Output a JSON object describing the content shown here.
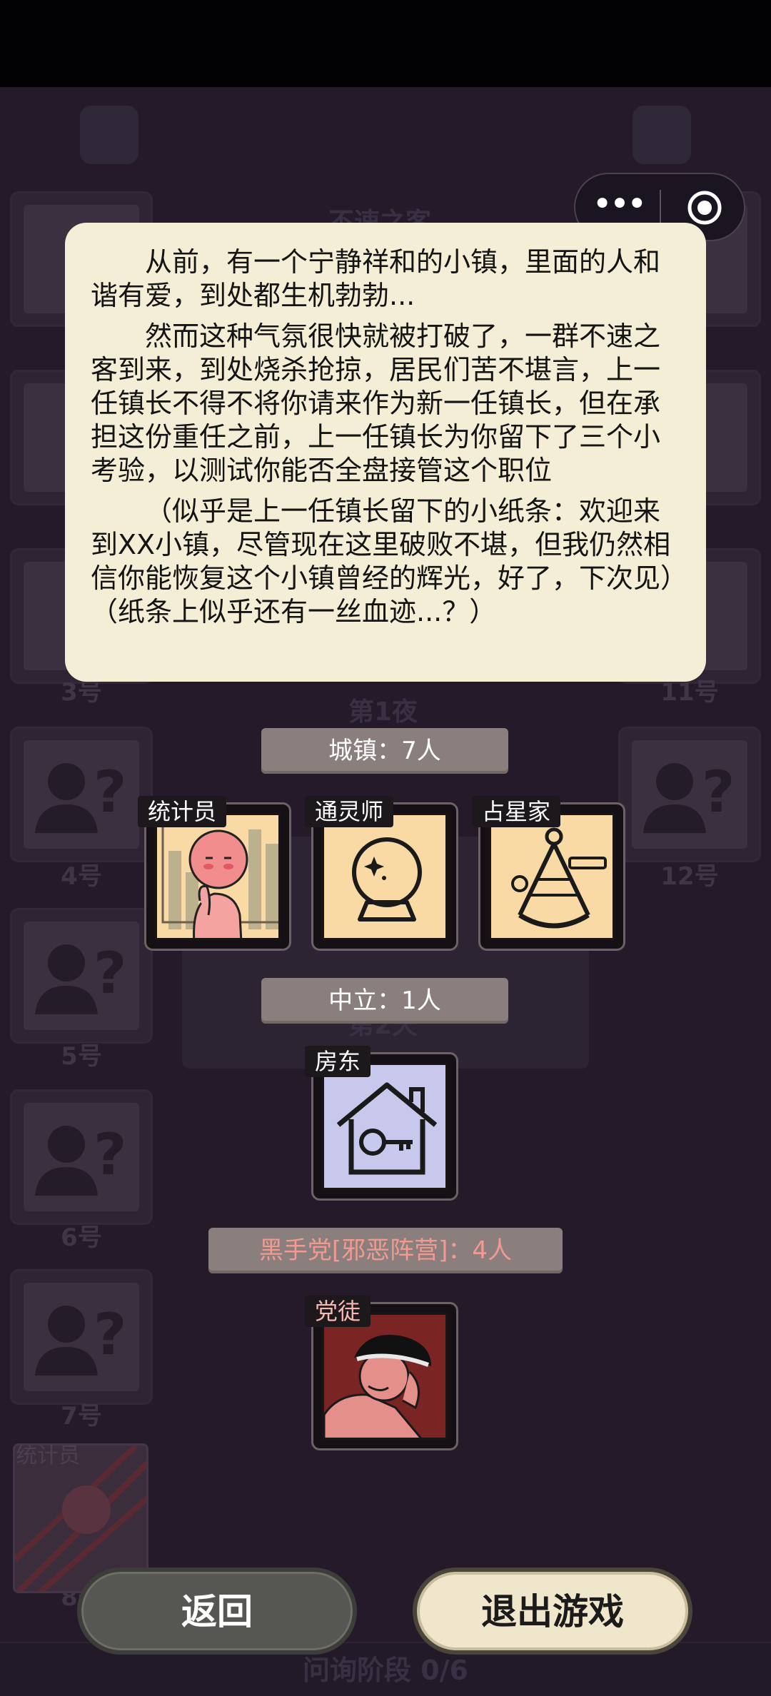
{
  "capsule": {
    "more_label": "•••"
  },
  "background": {
    "slot_numbers": [
      "3号",
      "4号",
      "5号",
      "6号",
      "7号",
      "8号",
      "11号",
      "12号"
    ],
    "night_label": "第1夜",
    "day_label": "第2天",
    "title_hint": "不速之客",
    "stat_label": "统计员",
    "phase_label": "问询阶段 0/6"
  },
  "story": {
    "paragraphs": [
      "从前，有一个宁静祥和的小镇，里面的人和谐有爱，到处都生机勃勃...",
      "然而这种气氛很快就被打破了，一群不速之客到来，到处烧杀抢掠，居民们苦不堪言，上一任镇长不得不将你请来作为新一任镇长，但在承担这份重任之前，上一任镇长为你留下了三个小考验，以测试你能否全盘接管这个职位",
      "（似乎是上一任镇长留下的小纸条：欢迎来到XX小镇，尽管现在这里破败不堪，但我仍然相信你能恢复这个小镇曾经的辉光，好了，下次见）（纸条上似乎还有一丝血迹...？）"
    ]
  },
  "sections": {
    "town": {
      "label": "城镇：7人",
      "roles": [
        "统计员",
        "通灵师",
        "占星家"
      ]
    },
    "neutral": {
      "label": "中立：1人",
      "roles": [
        "房东"
      ]
    },
    "evil": {
      "label": "黑手党[邪恶阵营]：4人",
      "roles": [
        "党徒"
      ]
    }
  },
  "buttons": {
    "back": "返回",
    "quit": "退出游戏"
  },
  "colors": {
    "dialog_bg": "#f4eed6",
    "section_bar": "#8a7f7c",
    "evil_text": "#f19a92",
    "town_card_bg": "#f9d9a4",
    "neutral_card_bg": "#c8c8ec",
    "evil_card_bg": "#7a2424",
    "back_button": "#565752",
    "quit_button": "#f0e6cb"
  }
}
